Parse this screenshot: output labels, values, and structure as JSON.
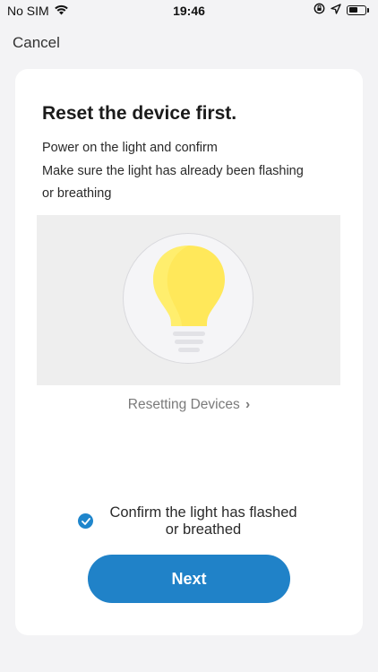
{
  "status_bar": {
    "carrier": "No SIM",
    "time": "19:46"
  },
  "nav": {
    "cancel_label": "Cancel"
  },
  "card": {
    "title": "Reset the device first.",
    "instructions": [
      "Power on the light and confirm",
      "Make sure the light has already been flashing",
      "or breathing"
    ],
    "resetting_link": "Resetting Devices",
    "resetting_chevron": "›",
    "confirm_text_line1": "Confirm the light has flashed",
    "confirm_text_line2": "or breathed",
    "confirm_checked": true,
    "next_label": "Next"
  },
  "colors": {
    "accent": "#2082c8",
    "bulb": "#ffe85a",
    "background": "#f3f3f5"
  },
  "icons": {
    "wifi": "wifi-icon",
    "location": "location-arrow-icon",
    "orientation_lock": "orientation-lock-icon",
    "battery": "battery-icon",
    "check": "checkmark-icon",
    "bulb": "light-bulb-icon"
  }
}
